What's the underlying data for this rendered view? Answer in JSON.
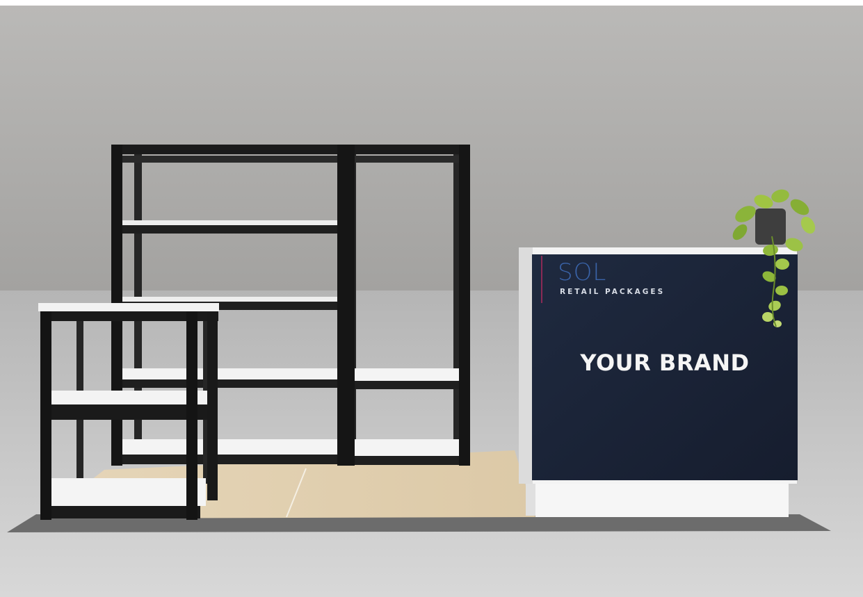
{
  "counter_panel": {
    "logo_title": "SOL",
    "logo_subtitle": "RETAIL PACKAGES",
    "headline": "YOUR BRAND"
  },
  "colors": {
    "wall": "#a7a6a4",
    "floor": "#c9c9c9",
    "panel": "#1b2438",
    "logo_blue": "#3a63a8",
    "accent_bar": "#8a2a55",
    "frame": "#1d1d1d",
    "shelf": "#f3f3f3",
    "wood_floor": "#e3d2b4",
    "counter_white": "#f4f4f4",
    "plant_green": "#8fb83a"
  }
}
